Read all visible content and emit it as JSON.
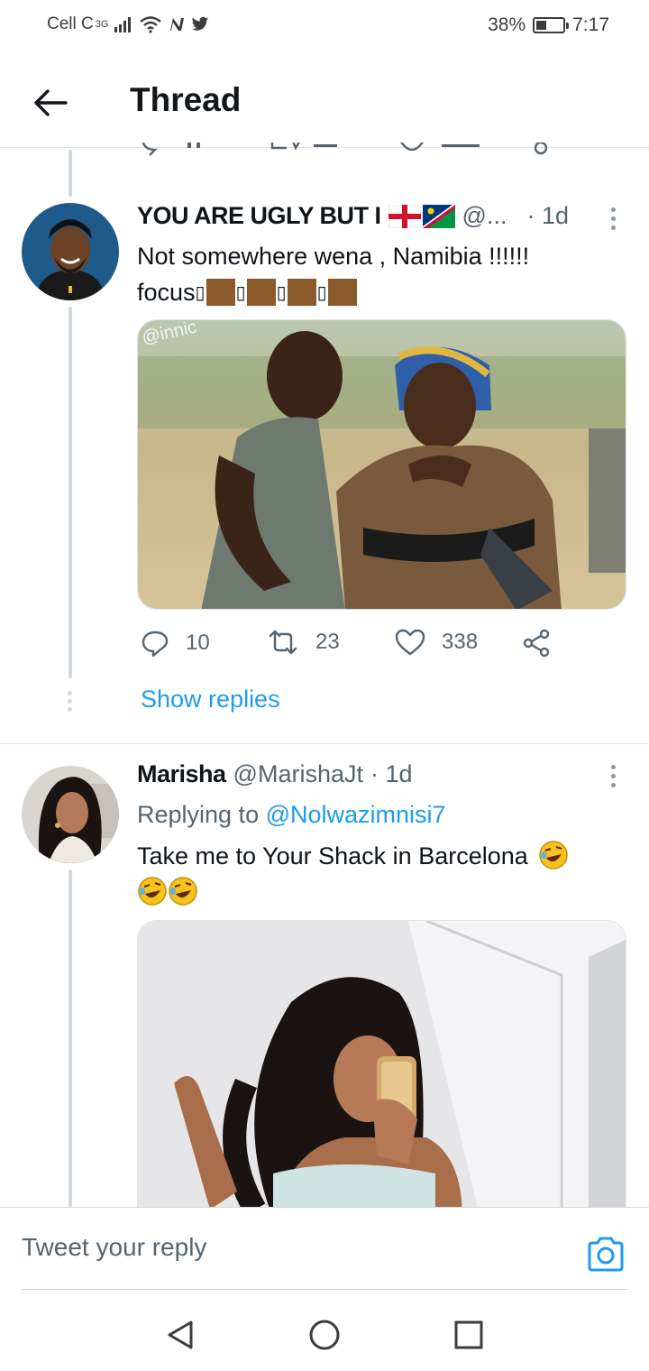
{
  "status_bar": {
    "carrier": "Cell C",
    "network": "3G",
    "battery": "38%",
    "battery_level": 0.38,
    "time": "7:17"
  },
  "header": {
    "title": "Thread"
  },
  "tweets": [
    {
      "display_name": "YOU ARE UGLY BUT I",
      "handle": "@...",
      "time": "· 1d",
      "text_line1": "Not somewhere wena , Namibia !!!!!!",
      "text_line2": "focus",
      "image_watermark": "@innic",
      "actions": {
        "replies": "10",
        "retweets": "23",
        "likes": "338"
      },
      "show_replies": "Show replies"
    },
    {
      "display_name": "Marisha",
      "handle": "@MarishaJt",
      "time": "· 1d",
      "replying_label": "Replying to",
      "replying_to": "@Nolwazimnisi7",
      "text_line1": "Take me to Your Shack in Barcelona"
    }
  ],
  "reply_bar": {
    "placeholder": "Tweet your reply"
  },
  "icons": {
    "back": "arrow-left-icon",
    "camera": "camera-icon",
    "reply": "reply-icon",
    "retweet": "retweet-icon",
    "like": "heart-icon",
    "share": "share-icon"
  }
}
